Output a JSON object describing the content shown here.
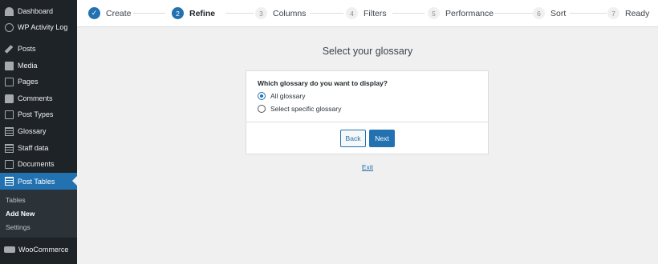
{
  "sidebar": {
    "items": [
      {
        "label": "Dashboard",
        "icon": "dashboard-icon"
      },
      {
        "label": "WP Activity Log",
        "icon": "activity-log-icon"
      },
      {
        "label": "Posts",
        "icon": "pin-icon"
      },
      {
        "label": "Media",
        "icon": "media-icon"
      },
      {
        "label": "Pages",
        "icon": "pages-icon"
      },
      {
        "label": "Comments",
        "icon": "comment-icon"
      },
      {
        "label": "Post Types",
        "icon": "post-types-icon"
      },
      {
        "label": "Glossary",
        "icon": "table-icon"
      },
      {
        "label": "Staff data",
        "icon": "table-icon"
      },
      {
        "label": "Documents",
        "icon": "documents-icon"
      },
      {
        "label": "Post Tables",
        "icon": "table-icon",
        "active": true
      },
      {
        "label": "WooCommerce",
        "icon": "woocommerce-icon"
      }
    ],
    "submenu": [
      {
        "label": "Tables"
      },
      {
        "label": "Add New",
        "current": true
      },
      {
        "label": "Settings"
      }
    ],
    "colors": {
      "background": "#1d2327",
      "active": "#2271b1",
      "submenu": "#2c3338"
    }
  },
  "stepper": {
    "steps": [
      {
        "number": "1",
        "label": "Create",
        "state": "done",
        "icon": "checkmark-icon"
      },
      {
        "number": "2",
        "label": "Refine",
        "state": "current"
      },
      {
        "number": "3",
        "label": "Columns",
        "state": "upcoming"
      },
      {
        "number": "4",
        "label": "Filters",
        "state": "upcoming"
      },
      {
        "number": "5",
        "label": "Performance",
        "state": "upcoming"
      },
      {
        "number": "6",
        "label": "Sort",
        "state": "upcoming"
      },
      {
        "number": "7",
        "label": "Ready",
        "state": "upcoming"
      }
    ],
    "done_symbol": "✓"
  },
  "main": {
    "title": "Select your glossary",
    "question": "Which glossary do you want to display?",
    "options": [
      {
        "label": "All glossary",
        "selected": true
      },
      {
        "label": "Select specific glossary",
        "selected": false
      }
    ],
    "back_label": "Back",
    "next_label": "Next",
    "exit_label": "Exit",
    "accent_color": "#2271b1"
  }
}
